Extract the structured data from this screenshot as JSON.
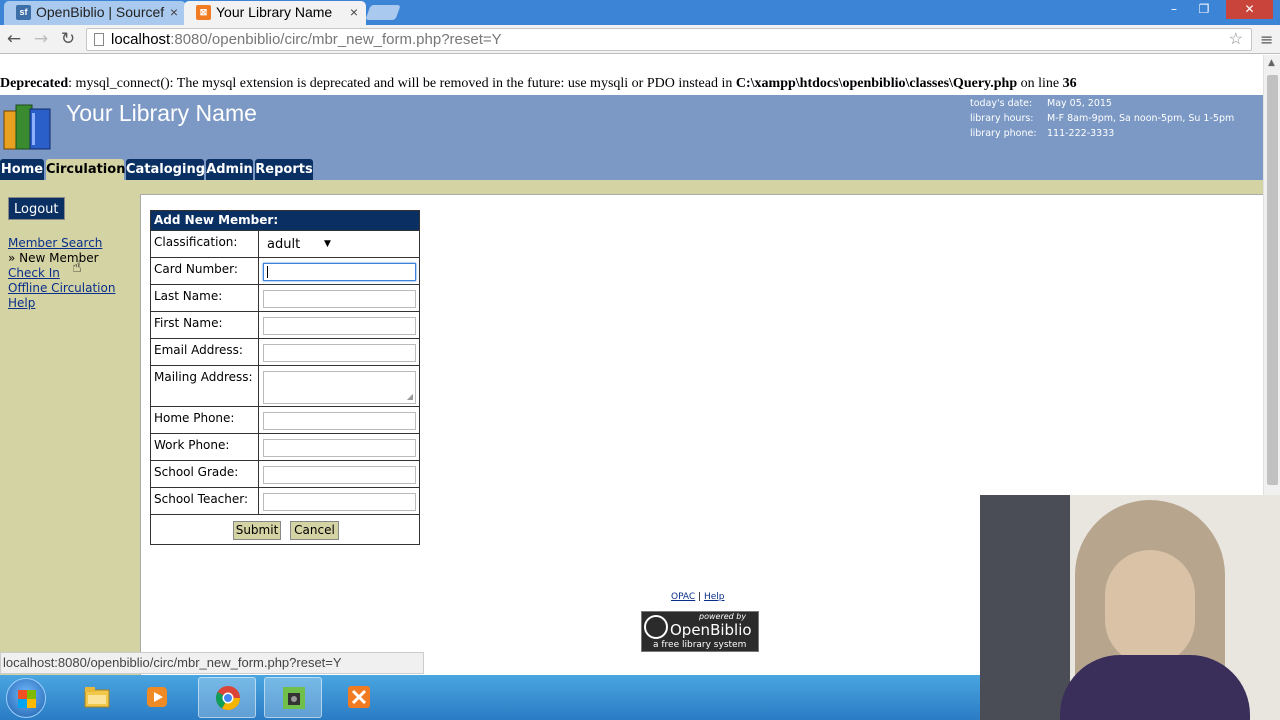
{
  "browser": {
    "tabs": [
      {
        "title": "OpenBiblio | Sourcef",
        "favicon": "sf",
        "active": false
      },
      {
        "title": "Your Library Name",
        "favicon": "xampp",
        "active": true
      }
    ],
    "tab_close_glyph": "×",
    "url_host": "localhost",
    "url_rest": ":8080/openbiblio/circ/mbr_new_form.php?reset=Y",
    "window_controls": {
      "minimize": "–",
      "maximize": "❐",
      "close": "✕"
    }
  },
  "page": {
    "deprecation": {
      "label": "Deprecated",
      "message": ": mysql_connect(): The mysql extension is deprecated and will be removed in the future: use mysqli or PDO instead in ",
      "path": "C:\\xampp\\htdocs\\openbiblio\\classes\\Query.php",
      "line_text": " on line ",
      "line_number": "36"
    },
    "header": {
      "library_name": "Your Library Name",
      "info": [
        {
          "label": "today's date:",
          "value": "May 05, 2015"
        },
        {
          "label": "library hours:",
          "value": "M-F 8am-9pm, Sa noon-5pm, Su 1-5pm"
        },
        {
          "label": "library phone:",
          "value": "111-222-3333"
        }
      ]
    },
    "nav_tabs": [
      "Home",
      "Circulation",
      "Cataloging",
      "Admin",
      "Reports"
    ],
    "selected_tab": "Circulation",
    "sidebar": {
      "logout": "Logout",
      "links": {
        "member_search": "Member Search",
        "new_member": "» New Member",
        "check_in": "Check In",
        "offline_circulation": "Offline Circulation",
        "help": "Help"
      }
    },
    "form": {
      "title": "Add New Member:",
      "classification_label": "Classification:",
      "classification_value": "adult",
      "fields": {
        "card_number": "Card Number:",
        "last_name": "Last Name:",
        "first_name": "First Name:",
        "email": "Email Address:",
        "mailing_address": "Mailing Address:",
        "home_phone": "Home Phone:",
        "work_phone": "Work Phone:",
        "school_grade": "School Grade:",
        "school_teacher": "School Teacher:"
      },
      "submit": "Submit",
      "cancel": "Cancel"
    },
    "footer": {
      "opac": "OPAC",
      "separator": " | ",
      "help": "Help",
      "powered_by": "powered by",
      "brand": "OpenBiblio",
      "tagline": "a free library system"
    },
    "status_url": "localhost:8080/openbiblio/circ/mbr_new_form.php?reset=Y"
  },
  "colors": {
    "header_bg": "#7b99c4",
    "nav_tab_bg": "#0a3063",
    "content_bg": "#d4d3a4",
    "taskbar": "#2a7cc4"
  },
  "taskbar": {
    "apps": [
      "windows-explorer-icon",
      "media-player-icon",
      "chrome-icon",
      "camera-app-icon",
      "xampp-icon"
    ]
  }
}
